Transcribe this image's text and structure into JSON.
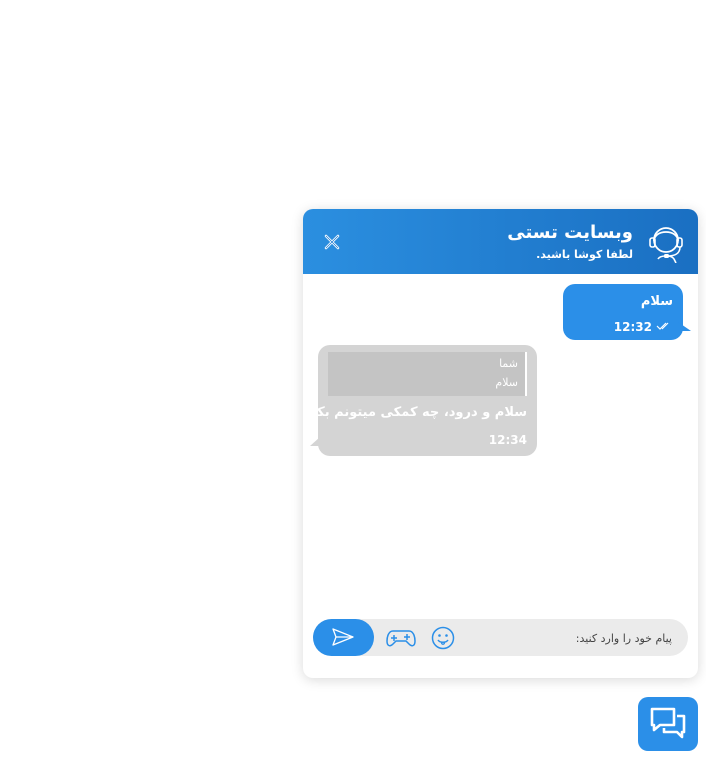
{
  "header": {
    "title": "وبسایت تستی",
    "subtitle": "لطفا کوشا باشید.",
    "avatar_icon": "support-agent-headset",
    "close_icon": "close-x",
    "gradient": [
      "#2b8fe0",
      "#1a6fc2"
    ]
  },
  "messages": {
    "outgoing": {
      "text": "سلام",
      "time": "12:32",
      "status_icon": "double-check"
    },
    "incoming": {
      "reply_to": {
        "name": "شما",
        "text": "سلام"
      },
      "text": "سلام و درود، چه کمکی میتونم بکنم؟",
      "time": "12:34"
    }
  },
  "composer": {
    "placeholder": "پیام خود را وارد کنید:",
    "value": "",
    "send_icon": "send-paper-plane",
    "game_icon": "gamepad",
    "emoji_icon": "smiley"
  },
  "launcher": {
    "icon": "chat-bubbles"
  },
  "colors": {
    "accent": "#2b8fe8",
    "incoming_bubble": "#d4d4d4",
    "input_bg": "#ebebeb"
  }
}
